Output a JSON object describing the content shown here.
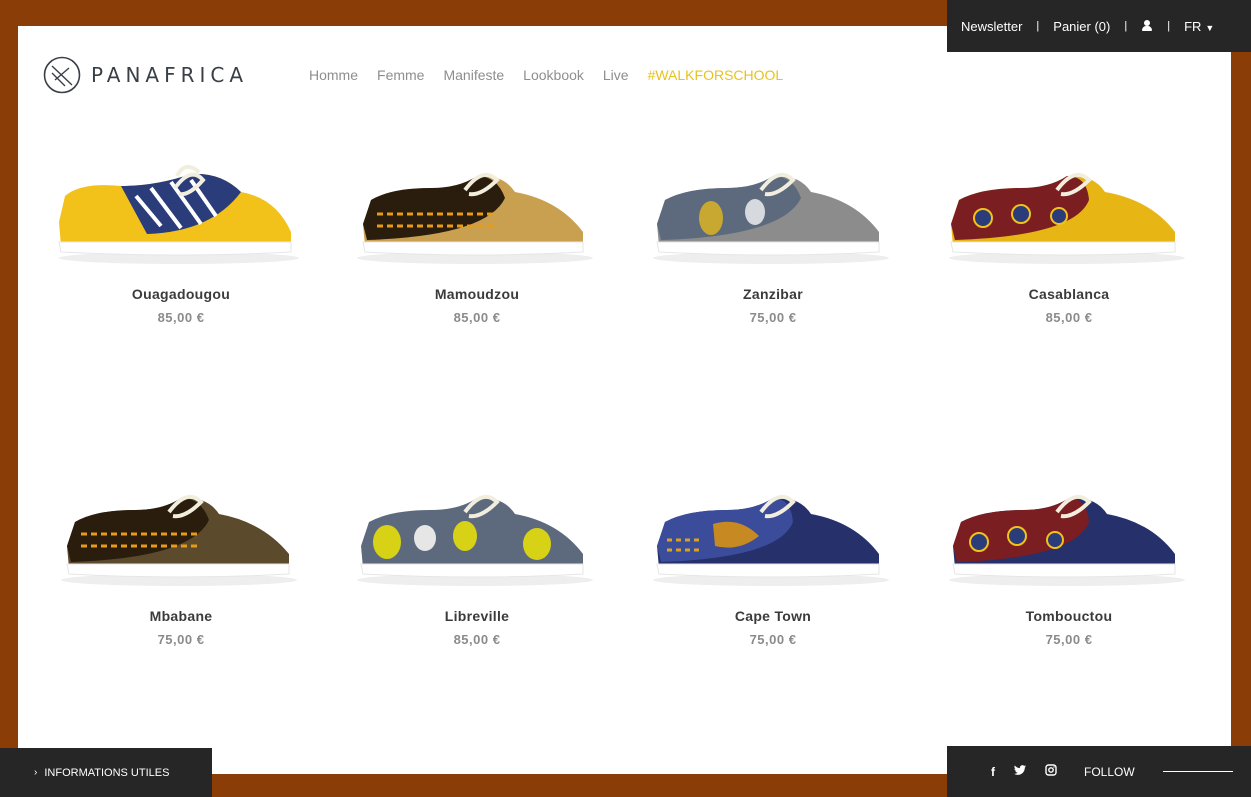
{
  "topbar": {
    "newsletter": "Newsletter",
    "cart": "Panier (0)",
    "user_icon": "user-icon",
    "language": "FR"
  },
  "header": {
    "brand": "PANAFRICA",
    "nav": [
      "Homme",
      "Femme",
      "Manifeste",
      "Lookbook",
      "Live",
      "#WALKFORSCHOOL"
    ]
  },
  "products": [
    {
      "name": "Ouagadougou",
      "price": "85,00 €"
    },
    {
      "name": "Mamoudzou",
      "price": "85,00 €"
    },
    {
      "name": "Zanzibar",
      "price": "75,00 €"
    },
    {
      "name": "Casablanca",
      "price": "85,00 €"
    },
    {
      "name": "Mbabane",
      "price": "75,00 €"
    },
    {
      "name": "Libreville",
      "price": "85,00 €"
    },
    {
      "name": "Cape Town",
      "price": "75,00 €"
    },
    {
      "name": "Tombouctou",
      "price": "75,00 €"
    }
  ],
  "footer": {
    "info": "INFORMATIONS UTILES",
    "follow": "FOLLOW",
    "social_icons": [
      "facebook-icon",
      "twitter-icon",
      "instagram-icon"
    ]
  },
  "colors": {
    "background": "#8a3d06",
    "bar": "#262626",
    "highlight_nav": "#e8c21e"
  }
}
